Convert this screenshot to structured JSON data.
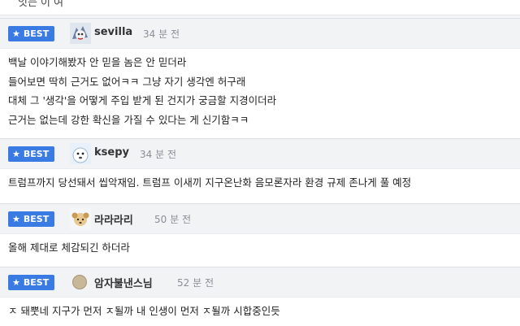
{
  "top_fragment": "잇는 이 여",
  "badge_label": "BEST",
  "comments": [
    {
      "nick": "sevilla",
      "time": "34 분 전",
      "lines": [
        "백날 이야기해봤자 안 믿을 놈은 안 믿더라",
        "들어보면 딱히 근거도 없어ㅋㅋ 그냥 자기 생각엔 허구래",
        "대체 그 '생각'을 어떻게 주입 받게 된 건지가 궁금할 지경이더라",
        "근거는 없는데 강한 확신을 가질 수 있다는 게 신기함ㅋㅋ"
      ]
    },
    {
      "nick": "ksepy",
      "time": "34 분 전",
      "lines": [
        "트럼프까지 당선돼서 씹악재임. 트럼프 이새끼 지구온난화 음모론자라 환경 규제 존나게 풀 예정"
      ]
    },
    {
      "nick": "라라라리",
      "time": "50 분 전",
      "lines": [
        "올해 제대로 체감되긴 하더라"
      ]
    },
    {
      "nick": "암자불낸스님",
      "time": "52 분 전",
      "lines": [
        "ㅈ 돼뿟네 지구가 먼저 ㅈ될까 내 인생이 먼저 ㅈ될까 시합중인듯"
      ]
    }
  ]
}
